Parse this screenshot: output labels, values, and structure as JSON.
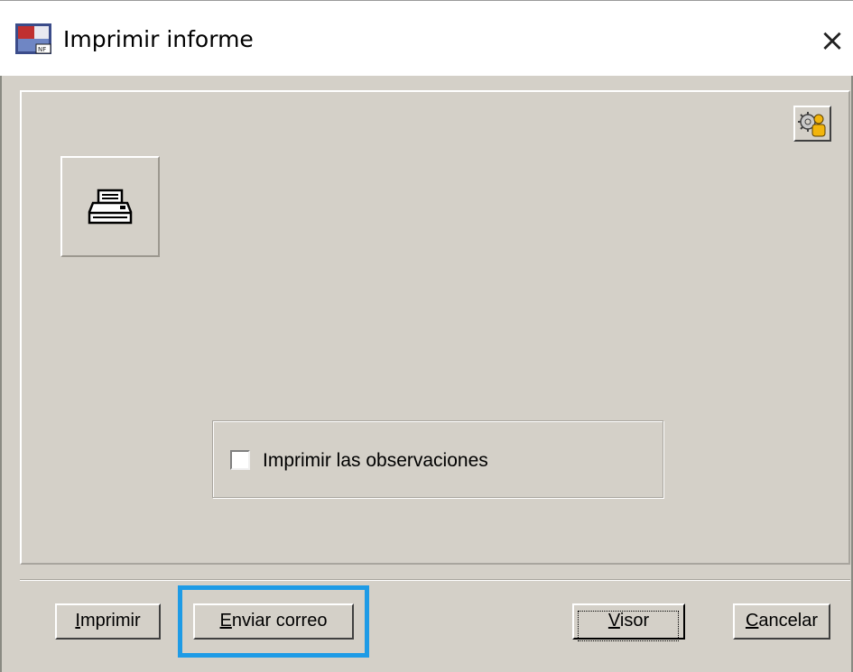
{
  "window": {
    "title": "Imprimir informe",
    "close_label": "×"
  },
  "main": {
    "options_button_icon": "gear-user-icon",
    "printer_icon": "printer-icon",
    "observations_checkbox": {
      "label": "Imprimir las observaciones",
      "checked": false
    }
  },
  "footer": {
    "buttons": [
      {
        "name": "imprimir",
        "label_u": "I",
        "label_rest": "mprimir"
      },
      {
        "name": "enviar-correo",
        "label_u": "E",
        "label_rest": "nviar correo"
      },
      {
        "name": "visor",
        "label_u": "V",
        "label_rest": "isor"
      },
      {
        "name": "cancelar",
        "label_u": "C",
        "label_rest": "ancelar"
      }
    ]
  },
  "annotation": {
    "highlight_color": "#1e9be6",
    "highlighted_button": "enviar-correo"
  }
}
